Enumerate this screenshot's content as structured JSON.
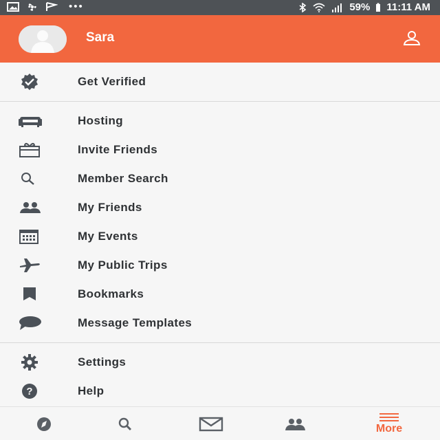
{
  "status_bar": {
    "battery": "59%",
    "time": "11:11 AM",
    "left_icons": [
      "image-icon",
      "fan-icon",
      "flag-icon",
      "more-dots-icon"
    ],
    "right_icons": [
      "bluetooth-icon",
      "wifi-icon",
      "signal-icon"
    ]
  },
  "header": {
    "user_name": "Sara",
    "background_color": "#f2673f"
  },
  "menu": {
    "items": [
      {
        "label": "Get Verified",
        "icon": "verified-badge-icon"
      },
      {
        "label": "Hosting",
        "icon": "couch-icon"
      },
      {
        "label": "Invite Friends",
        "icon": "gift-icon"
      },
      {
        "label": "Member Search",
        "icon": "search-icon"
      },
      {
        "label": "My Friends",
        "icon": "people-icon"
      },
      {
        "label": "My Events",
        "icon": "calendar-icon"
      },
      {
        "label": "My Public Trips",
        "icon": "airplane-icon"
      },
      {
        "label": "Bookmarks",
        "icon": "bookmark-icon"
      },
      {
        "label": "Message Templates",
        "icon": "chat-bubble-icon"
      },
      {
        "label": "Settings",
        "icon": "gear-icon"
      },
      {
        "label": "Help",
        "icon": "help-icon"
      }
    ]
  },
  "bottom_nav": {
    "items": [
      {
        "icon": "compass-icon"
      },
      {
        "icon": "search-icon"
      },
      {
        "icon": "mail-icon"
      },
      {
        "icon": "people-icon"
      },
      {
        "icon": "menu-icon",
        "label": "More",
        "active": true
      }
    ],
    "active_color": "#f2673f",
    "inactive_color": "#5b6066"
  }
}
